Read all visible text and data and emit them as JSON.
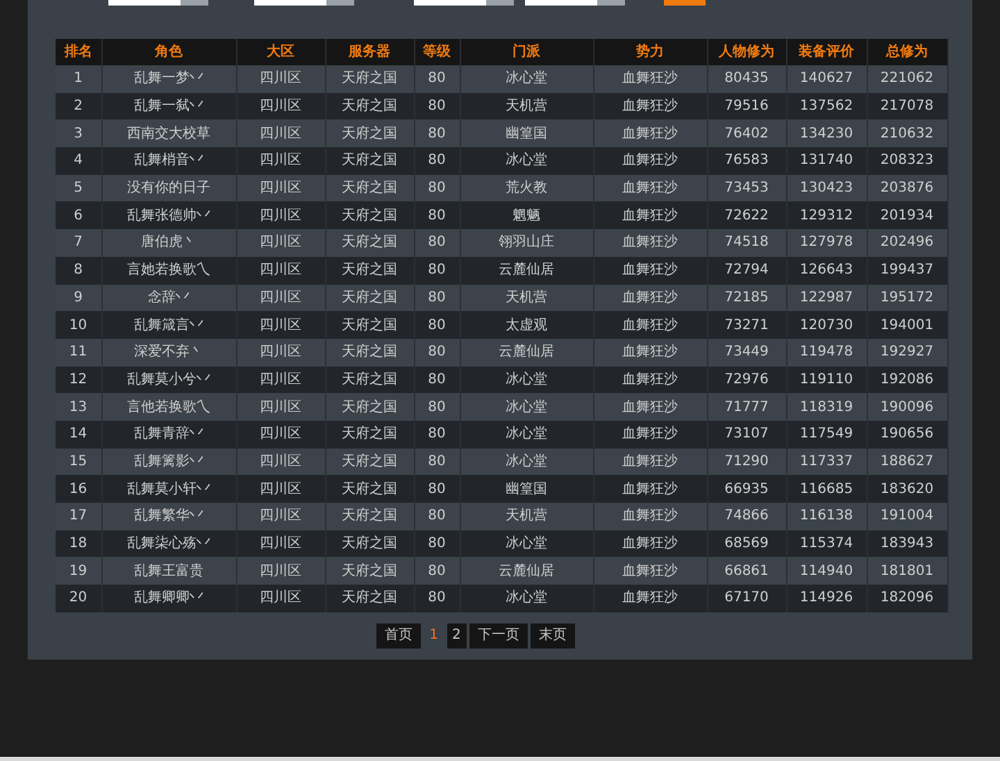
{
  "filters": [
    {
      "kind": "select"
    },
    {
      "kind": "select"
    },
    {
      "kind": "select"
    },
    {
      "kind": "select"
    }
  ],
  "search_button": {
    "kind": "button"
  },
  "table": {
    "columns": [
      "排名",
      "角色",
      "大区",
      "服务器",
      "等级",
      "门派",
      "势力",
      "人物修为",
      "装备评价",
      "总修为"
    ],
    "rows": [
      [
        "1",
        "乱舞一梦丷",
        "四川区",
        "天府之国",
        "80",
        "冰心堂",
        "血舞狂沙",
        "80435",
        "140627",
        "221062"
      ],
      [
        "2",
        "乱舞一弑丷",
        "四川区",
        "天府之国",
        "80",
        "天机营",
        "血舞狂沙",
        "79516",
        "137562",
        "217078"
      ],
      [
        "3",
        "西南交大校草",
        "四川区",
        "天府之国",
        "80",
        "幽篁国",
        "血舞狂沙",
        "76402",
        "134230",
        "210632"
      ],
      [
        "4",
        "乱舞梢音丷",
        "四川区",
        "天府之国",
        "80",
        "冰心堂",
        "血舞狂沙",
        "76583",
        "131740",
        "208323"
      ],
      [
        "5",
        "没有你的日子",
        "四川区",
        "天府之国",
        "80",
        "荒火教",
        "血舞狂沙",
        "73453",
        "130423",
        "203876"
      ],
      [
        "6",
        "乱舞张德帅丷",
        "四川区",
        "天府之国",
        "80",
        "魍魉",
        "血舞狂沙",
        "72622",
        "129312",
        "201934"
      ],
      [
        "7",
        "唐伯虎丶",
        "四川区",
        "天府之国",
        "80",
        "翎羽山庄",
        "血舞狂沙",
        "74518",
        "127978",
        "202496"
      ],
      [
        "8",
        "言她若换歌乀",
        "四川区",
        "天府之国",
        "80",
        "云麓仙居",
        "血舞狂沙",
        "72794",
        "126643",
        "199437"
      ],
      [
        "9",
        "念辞丷",
        "四川区",
        "天府之国",
        "80",
        "天机营",
        "血舞狂沙",
        "72185",
        "122987",
        "195172"
      ],
      [
        "10",
        "乱舞箴言丷",
        "四川区",
        "天府之国",
        "80",
        "太虚观",
        "血舞狂沙",
        "73271",
        "120730",
        "194001"
      ],
      [
        "11",
        "深爱不弃丶",
        "四川区",
        "天府之国",
        "80",
        "云麓仙居",
        "血舞狂沙",
        "73449",
        "119478",
        "192927"
      ],
      [
        "12",
        "乱舞莫小兮丷",
        "四川区",
        "天府之国",
        "80",
        "冰心堂",
        "血舞狂沙",
        "72976",
        "119110",
        "192086"
      ],
      [
        "13",
        "言他若换歌乀",
        "四川区",
        "天府之国",
        "80",
        "冰心堂",
        "血舞狂沙",
        "71777",
        "118319",
        "190096"
      ],
      [
        "14",
        "乱舞青辞丷",
        "四川区",
        "天府之国",
        "80",
        "冰心堂",
        "血舞狂沙",
        "73107",
        "117549",
        "190656"
      ],
      [
        "15",
        "乱舞篱影丷",
        "四川区",
        "天府之国",
        "80",
        "冰心堂",
        "血舞狂沙",
        "71290",
        "117337",
        "188627"
      ],
      [
        "16",
        "乱舞莫小轩丷",
        "四川区",
        "天府之国",
        "80",
        "幽篁国",
        "血舞狂沙",
        "66935",
        "116685",
        "183620"
      ],
      [
        "17",
        "乱舞繁华丷",
        "四川区",
        "天府之国",
        "80",
        "天机营",
        "血舞狂沙",
        "74866",
        "116138",
        "191004"
      ],
      [
        "18",
        "乱舞柒心殇丷",
        "四川区",
        "天府之国",
        "80",
        "冰心堂",
        "血舞狂沙",
        "68569",
        "115374",
        "183943"
      ],
      [
        "19",
        "乱舞王富贵",
        "四川区",
        "天府之国",
        "80",
        "云麓仙居",
        "血舞狂沙",
        "66861",
        "114940",
        "181801"
      ],
      [
        "20",
        "乱舞卿卿丷",
        "四川区",
        "天府之国",
        "80",
        "冰心堂",
        "血舞狂沙",
        "67170",
        "114926",
        "182096"
      ]
    ]
  },
  "pagination": [
    {
      "label": "首页",
      "kind": "link",
      "selected": false
    },
    {
      "label": "1",
      "kind": "page",
      "selected": true
    },
    {
      "label": "2",
      "kind": "page",
      "selected": false
    },
    {
      "label": "下一页",
      "kind": "link",
      "selected": false
    },
    {
      "label": "末页",
      "kind": "link",
      "selected": false
    }
  ]
}
